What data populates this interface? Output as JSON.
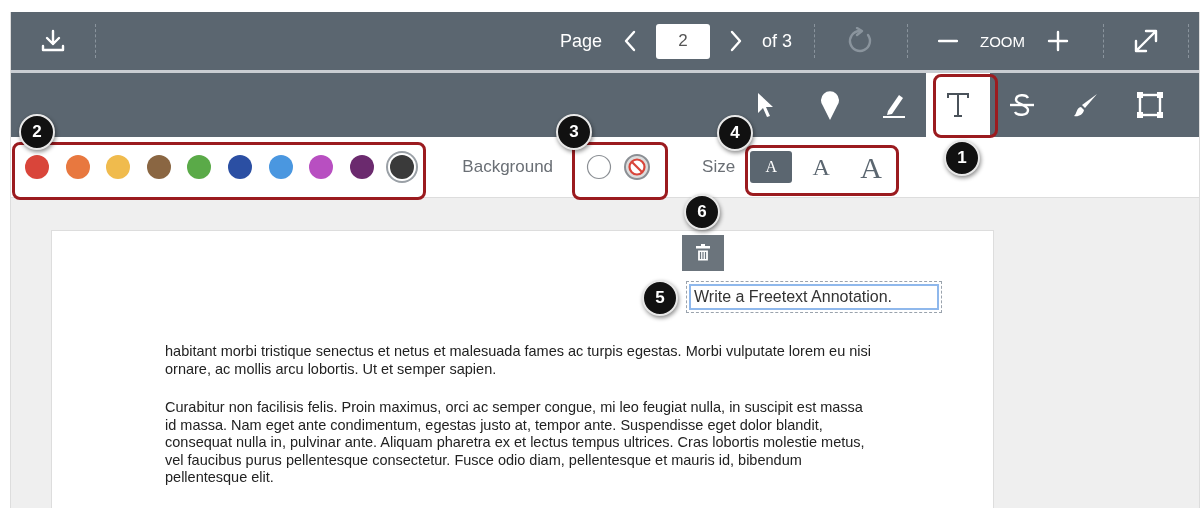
{
  "top_toolbar": {
    "page_label": "Page",
    "page_input": "2",
    "page_count": "of 3",
    "zoom_label": "ZOOM",
    "rotate_disabled": true
  },
  "tools": [
    {
      "kind": "pointer",
      "selected": false
    },
    {
      "kind": "pin",
      "selected": false
    },
    {
      "kind": "highlight",
      "selected": false
    },
    {
      "kind": "text",
      "selected": true
    },
    {
      "kind": "strikeout",
      "selected": false
    },
    {
      "kind": "draw",
      "selected": false
    },
    {
      "kind": "area",
      "selected": false
    }
  ],
  "colors": [
    {
      "color": "#d9453a",
      "selected": false
    },
    {
      "color": "#e8783f",
      "selected": false
    },
    {
      "color": "#f0bb4d",
      "selected": false
    },
    {
      "color": "#8a6642",
      "selected": false
    },
    {
      "color": "#5aaa48",
      "selected": false
    },
    {
      "color": "#2b4fa3",
      "selected": false
    },
    {
      "color": "#4a97e0",
      "selected": false
    },
    {
      "color": "#b84fc1",
      "selected": false
    },
    {
      "color": "#6b2a6e",
      "selected": false
    },
    {
      "color": "#3a3a3a",
      "selected": true
    }
  ],
  "background": {
    "label": "Background",
    "options": [
      {
        "kind": "fill",
        "selected": false
      },
      {
        "kind": "none",
        "selected": true
      }
    ]
  },
  "size": {
    "label": "Size",
    "options": [
      {
        "label": "A",
        "selected": true
      },
      {
        "label": "A",
        "selected": false
      },
      {
        "label": "A",
        "selected": false
      }
    ]
  },
  "document": {
    "annotation": "Write a Freetext Annotation.",
    "paragraphs": [
      "habitant morbi tristique senectus et netus et malesuada fames ac turpis egestas. Morbi vulputate lorem eu nisi ornare, ac mollis arcu lobortis. Ut et semper sapien.",
      "Curabitur non facilisis felis. Proin maximus, orci ac semper congue, mi leo feugiat nulla, in suscipit est massa id massa. Nam eget ante condimentum, egestas justo at, tempor ante. Suspendisse eget dolor blandit, consequat nulla in, pulvinar ante. Aliquam pharetra ex et lectus tempus ultrices. Cras lobortis molestie metus, vel faucibus purus pellentesque consectetur. Fusce odio diam, pellentesque et mauris id, bibendum pellentesque elit."
    ]
  },
  "callouts": [
    {
      "number": "1"
    },
    {
      "number": "2"
    },
    {
      "number": "3"
    },
    {
      "number": "4"
    },
    {
      "number": "5"
    },
    {
      "number": "6"
    }
  ]
}
